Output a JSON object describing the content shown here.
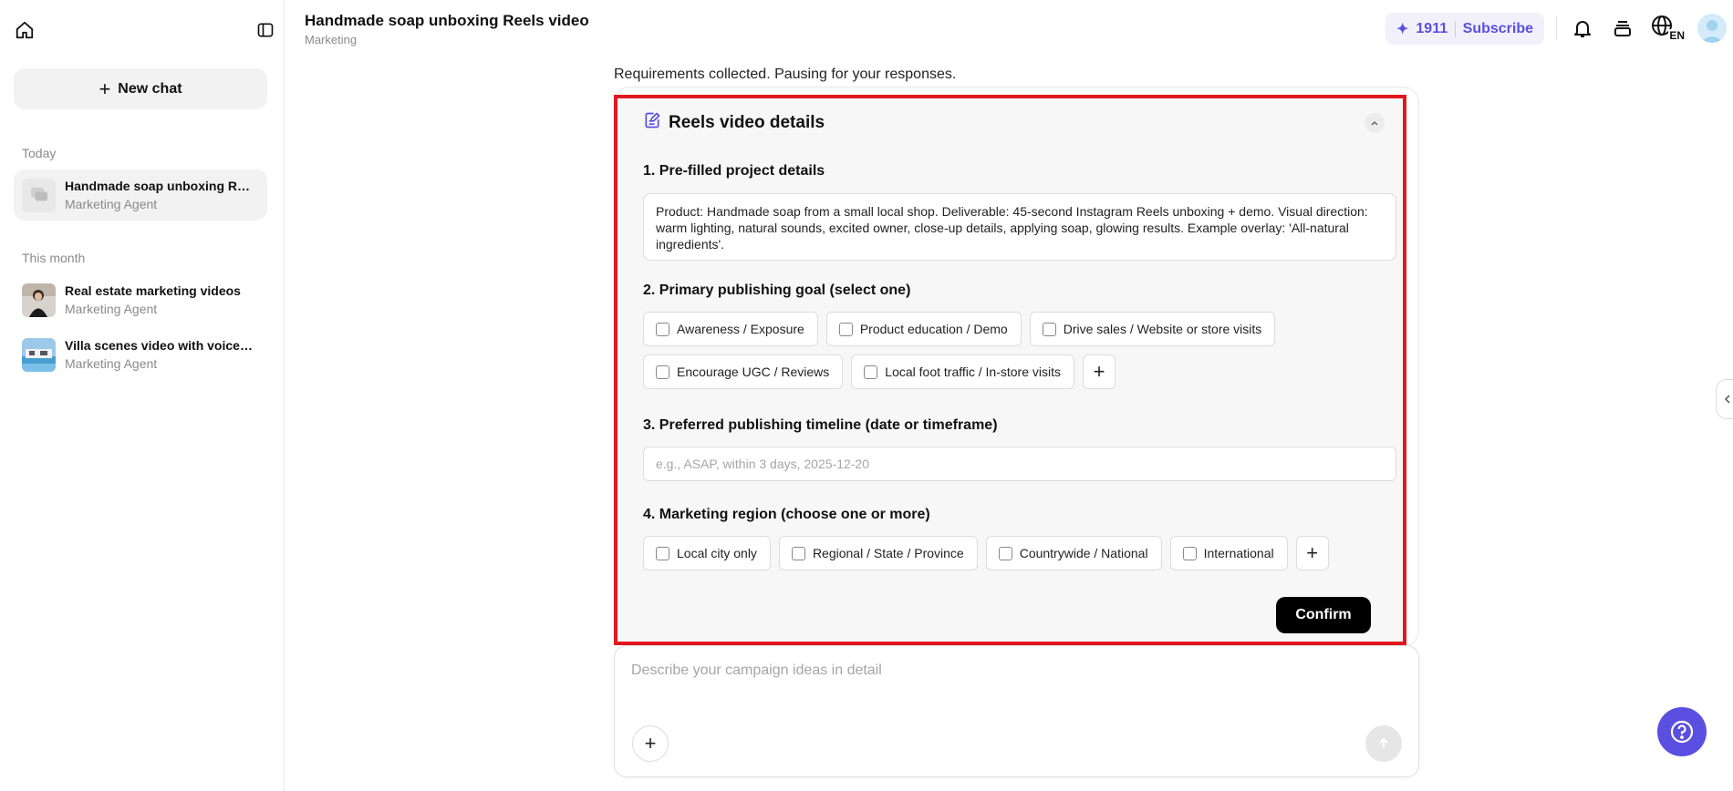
{
  "sidebar": {
    "new_chat_label": "New chat",
    "sections": [
      {
        "label": "Today"
      },
      {
        "label": "This month"
      }
    ],
    "chats": [
      {
        "title": "Handmade soap unboxing Reel...",
        "subtitle": "Marketing Agent",
        "active": true
      },
      {
        "title": "Real estate marketing videos",
        "subtitle": "Marketing Agent",
        "active": false
      },
      {
        "title": "Villa scenes video with voiceover",
        "subtitle": "Marketing Agent",
        "active": false
      }
    ]
  },
  "header": {
    "title": "Handmade soap unboxing Reels video",
    "subtitle": "Marketing",
    "credits": "1911",
    "subscribe_label": "Subscribe",
    "language_badge": "EN"
  },
  "main": {
    "status_text": "Requirements collected. Pausing for your responses.",
    "card": {
      "title": "Reels video details",
      "q1_label": "1. Pre-filled project details",
      "q1_text": "Product: Handmade soap from a small local shop. Deliverable: 45-second Instagram Reels unboxing + demo. Visual direction: warm lighting, natural sounds, excited owner, close-up details, applying soap, glowing results. Example overlay: 'All-natural ingredients'.",
      "q2_label": "2. Primary publishing goal (select one)",
      "q2_options": [
        "Awareness / Exposure",
        "Product education / Demo",
        "Drive sales / Website or store visits",
        "Encourage UGC / Reviews",
        "Local foot traffic / In-store visits"
      ],
      "q3_label": "3. Preferred publishing timeline (date or timeframe)",
      "q3_placeholder": "e.g., ASAP, within 3 days, 2025-12-20",
      "q4_label": "4. Marketing region (choose one or more)",
      "q4_options": [
        "Local city only",
        "Regional / State / Province",
        "Countrywide / National",
        "International"
      ],
      "confirm_label": "Confirm"
    },
    "composer": {
      "placeholder": "Describe your campaign ideas in detail"
    }
  },
  "colors": {
    "accent": "#5a4fe0",
    "highlight_border": "#e0191f",
    "primary_button": "#000000"
  }
}
